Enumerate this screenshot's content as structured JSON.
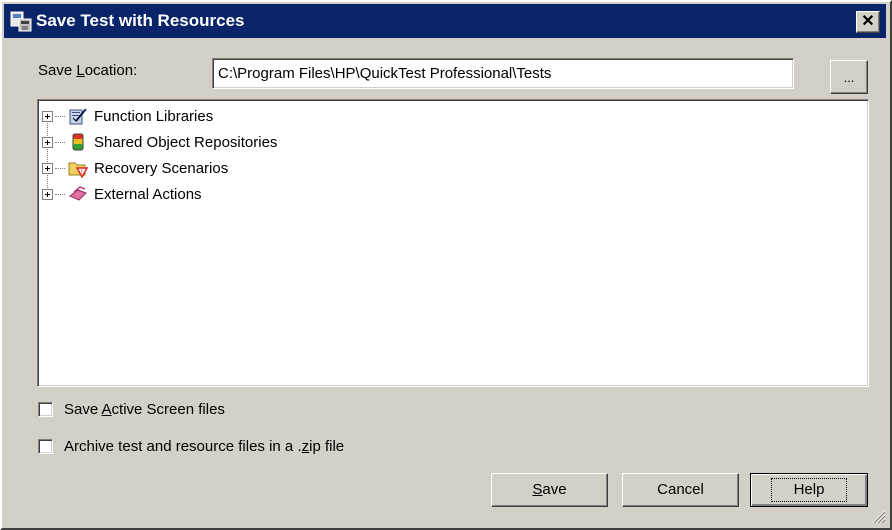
{
  "window": {
    "title": "Save Test with Resources",
    "close_glyph": "✕"
  },
  "location": {
    "label_pre": "Save ",
    "label_key": "L",
    "label_post": "ocation:",
    "value": "C:\\Program Files\\HP\\QuickTest Professional\\Tests",
    "browse_label": "..."
  },
  "tree": {
    "items": [
      {
        "label": "Function Libraries",
        "icon": "function-library-icon"
      },
      {
        "label": "Shared Object Repositories",
        "icon": "object-repository-icon"
      },
      {
        "label": "Recovery Scenarios",
        "icon": "recovery-scenario-folder-icon"
      },
      {
        "label": "External Actions",
        "icon": "external-actions-icon"
      }
    ]
  },
  "options": {
    "active_screen": {
      "pre": "Save ",
      "key": "A",
      "post": "ctive Screen files",
      "checked": false
    },
    "archive": {
      "pre": "Archive test and resource files in a .",
      "key": "z",
      "post": "ip file",
      "checked": false
    }
  },
  "buttons": {
    "save": {
      "key": "S",
      "rest": "ave"
    },
    "cancel": "Cancel",
    "help": "Help"
  },
  "colors": {
    "titlebar": "#0a246a",
    "face": "#d4d0c8"
  }
}
